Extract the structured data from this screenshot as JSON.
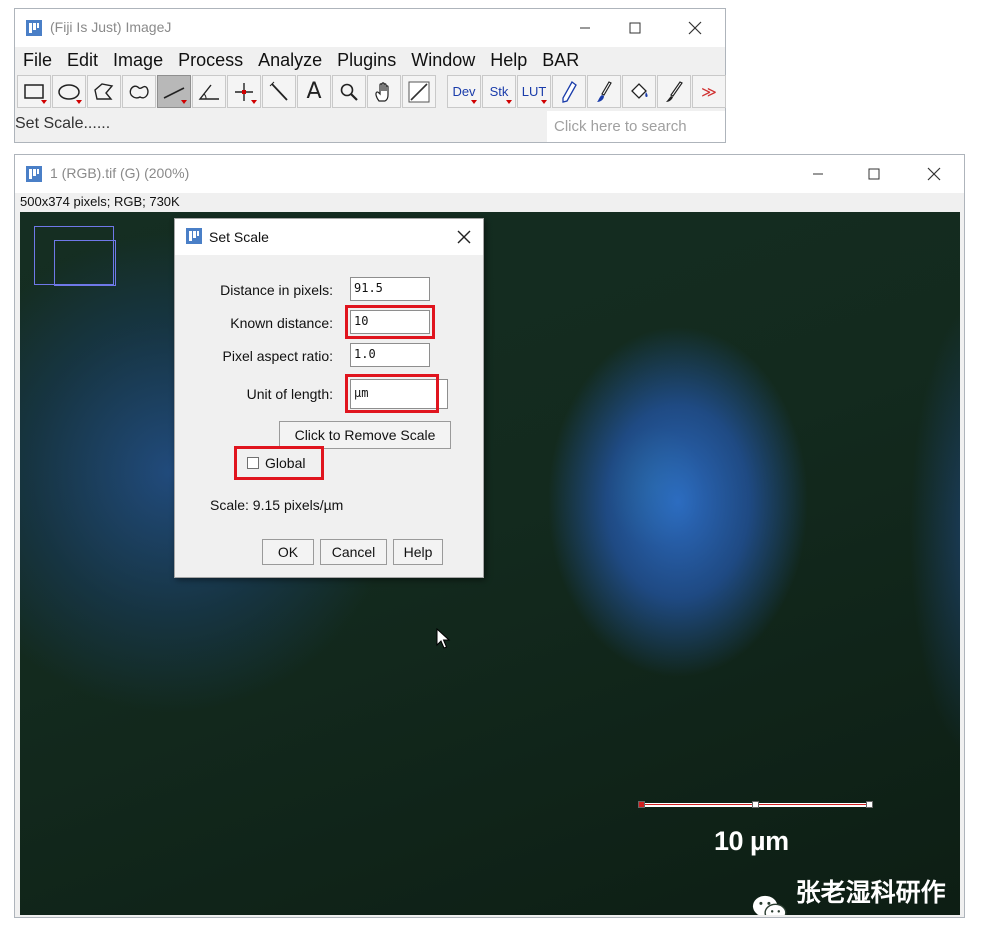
{
  "main_window": {
    "title": "(Fiji Is Just) ImageJ",
    "menu": [
      "File",
      "Edit",
      "Image",
      "Process",
      "Analyze",
      "Plugins",
      "Window",
      "Help",
      "BAR"
    ],
    "tools": {
      "dev": "Dev",
      "stk": "Stk",
      "lut": "LUT",
      "text_tool": "A",
      "more": "≫"
    },
    "status": "Set Scale......",
    "search_placeholder": "Click here to search"
  },
  "image_window": {
    "title": "1 (RGB).tif (G) (200%)",
    "info": "500x374 pixels; RGB; 730K",
    "scale_label": "10 µm",
    "watermark": "张老湿科研作图"
  },
  "set_scale": {
    "title": "Set Scale",
    "fields": [
      {
        "label": "Distance in pixels:",
        "value": "91.5"
      },
      {
        "label": "Known distance:",
        "value": "10"
      },
      {
        "label": "Pixel aspect ratio:",
        "value": "1.0"
      },
      {
        "label": "Unit of length:",
        "value": "µm"
      }
    ],
    "remove_scale_label": "Click to Remove Scale",
    "global_label": "Global",
    "global_checked": false,
    "scale_text": "Scale: 9.15 pixels/µm",
    "ok_label": "OK",
    "cancel_label": "Cancel",
    "help_label": "Help"
  },
  "colors": {
    "highlight": "#e0141e",
    "scale_bar": "#ffffff",
    "overlay_line": "#d02020",
    "navigator": "#6f78e8"
  }
}
